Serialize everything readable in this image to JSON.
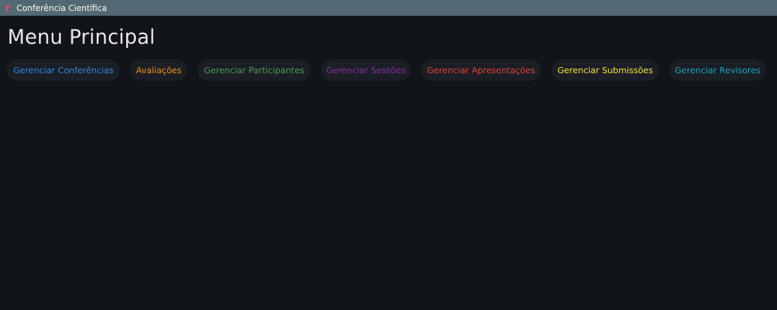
{
  "window": {
    "title": "Conferência Científica",
    "icon": "flutter-logo-icon"
  },
  "main": {
    "title": "Menu Principal"
  },
  "menu": {
    "items": [
      {
        "label": "Gerenciar Conferências",
        "color": "#2d8ce0"
      },
      {
        "label": "Avaliações",
        "color": "#f0921e"
      },
      {
        "label": "Gerenciar Participantes",
        "color": "#48a24d"
      },
      {
        "label": "Gerenciar Sessões",
        "color": "#8e2aa8"
      },
      {
        "label": "Gerenciar Apresentações",
        "color": "#e2443a"
      },
      {
        "label": "Gerenciar Submissões",
        "color": "#f5e33b"
      },
      {
        "label": "Gerenciar Revisores",
        "color": "#16a6bf"
      }
    ]
  }
}
